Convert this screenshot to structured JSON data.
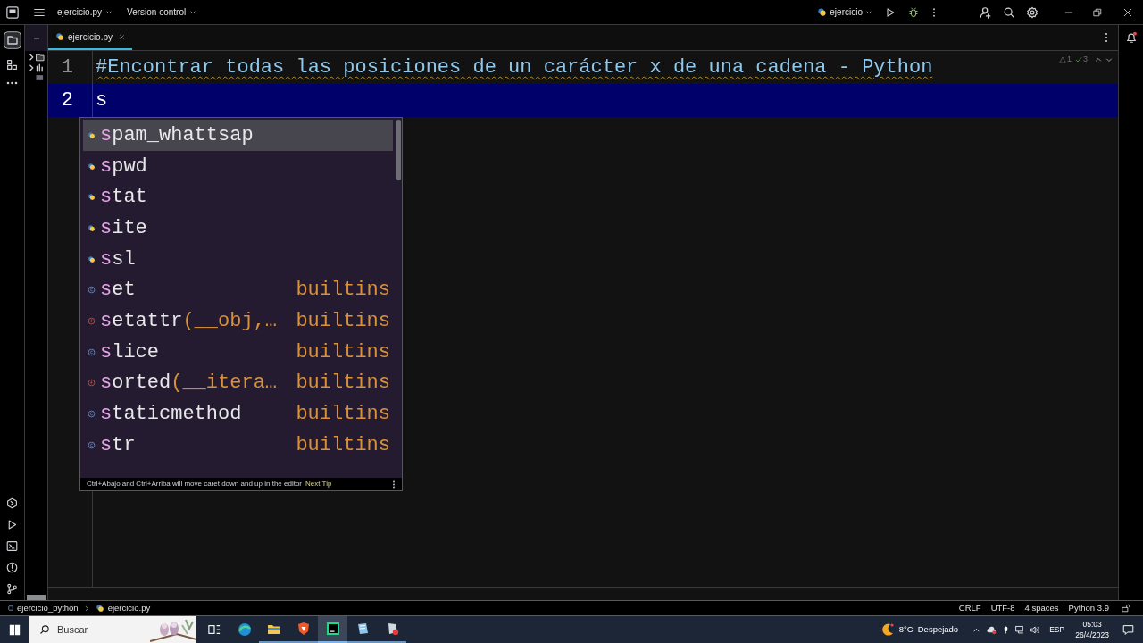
{
  "title_bar": {
    "file": "ejercicio.py",
    "vcs": "Version control",
    "run_config": "ejercicio"
  },
  "editor_tab": {
    "label": "ejercicio.py",
    "selected": true
  },
  "inspections": {
    "warnings": "1",
    "ok": "3"
  },
  "lines": [
    {
      "number": "1",
      "text": "#Encontrar todas las posiciones de un carácter x de una cadena - Python",
      "kind": "comment",
      "current": false
    },
    {
      "number": "2",
      "text": "s",
      "kind": "code",
      "current": true
    }
  ],
  "completion": {
    "items": [
      {
        "kind": "module",
        "match": "s",
        "rest": "pam_whattsap",
        "selected": true
      },
      {
        "kind": "module",
        "match": "s",
        "rest": "pwd",
        "selected": false
      },
      {
        "kind": "module",
        "match": "s",
        "rest": "tat",
        "selected": false
      },
      {
        "kind": "module",
        "match": "s",
        "rest": "ite",
        "selected": false
      },
      {
        "kind": "module",
        "match": "s",
        "rest": "sl",
        "selected": false
      },
      {
        "kind": "class",
        "match": "s",
        "rest": "et",
        "source": "builtins",
        "selected": false
      },
      {
        "kind": "function",
        "match": "s",
        "rest": "etattr",
        "params": "(__obj,…",
        "source": "builtins",
        "selected": false
      },
      {
        "kind": "class",
        "match": "s",
        "rest": "lice",
        "source": "builtins",
        "selected": false
      },
      {
        "kind": "function",
        "match": "s",
        "rest": "orted",
        "params": "(__itera…",
        "source": "builtins",
        "selected": false
      },
      {
        "kind": "class",
        "match": "s",
        "rest": "taticmethod",
        "source": "builtins",
        "selected": false
      },
      {
        "kind": "class",
        "match": "s",
        "rest": "tr",
        "source": "builtins",
        "selected": false
      }
    ],
    "tip": "Ctrl+Abajo and Ctrl+Arriba will move caret down and up in the editor",
    "tip_link": "Next Tip"
  },
  "breadcrumbs": [
    "ejercicio_python",
    "ejercicio.py"
  ],
  "status": [
    "CRLF",
    "UTF-8",
    "4 spaces",
    "Python 3.9"
  ],
  "taskbar": {
    "search_placeholder": "Buscar",
    "temperature": "8°C",
    "weather": "Despejado",
    "language": "ESP",
    "time": "05:03",
    "date": "26/4/2023"
  }
}
